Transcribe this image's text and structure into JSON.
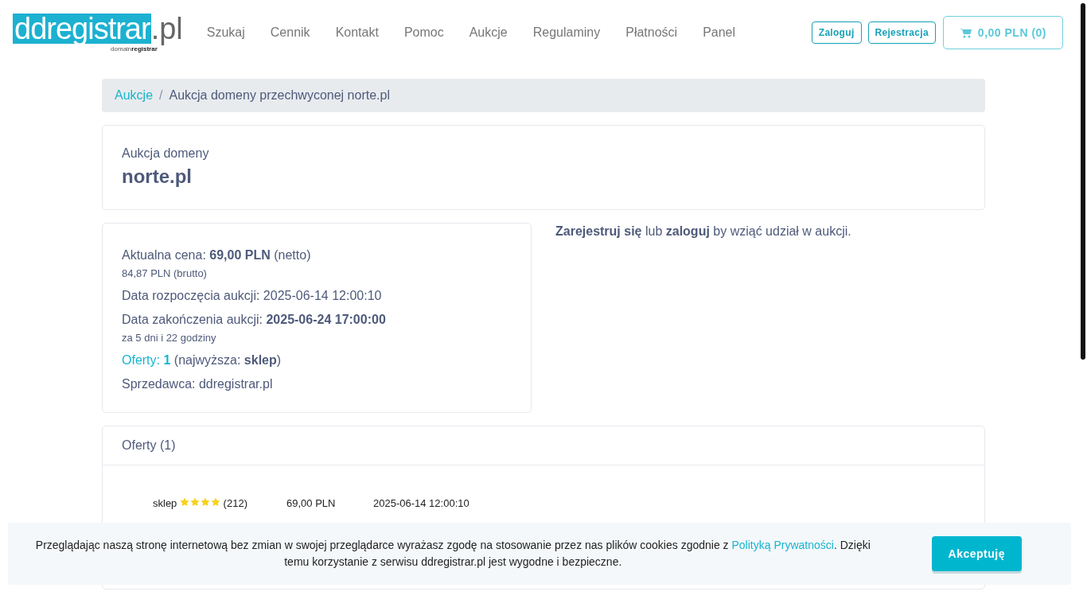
{
  "logo": {
    "main": "ddregistrar",
    "suffix": ".pl",
    "tagline_light": "domain",
    "tagline_bold": "registrar"
  },
  "nav": [
    {
      "label": "Szukaj"
    },
    {
      "label": "Cennik"
    },
    {
      "label": "Kontakt"
    },
    {
      "label": "Pomoc"
    },
    {
      "label": "Aukcje"
    },
    {
      "label": "Regulaminy"
    },
    {
      "label": "Płatności"
    },
    {
      "label": "Panel"
    }
  ],
  "header_buttons": [
    "Zaloguj",
    "Rejestracja"
  ],
  "cart": {
    "label": "0,00 PLN (0)"
  },
  "breadcrumb_separator": "/",
  "breadcrumb": [
    {
      "label": "Aukcje",
      "kind": "link"
    },
    {
      "label": "Aukcja domeny przechwyconej norte.pl",
      "kind": "current"
    }
  ],
  "title_card": {
    "subtitle": "Aukcja domeny",
    "domain": "norte.pl"
  },
  "details": [
    {
      "kind": "main",
      "text": "Aktualna cena: **69,00 PLN** (netto)"
    },
    {
      "kind": "note",
      "text": "84,87 PLN (brutto)"
    },
    {
      "kind": "main",
      "text": "Data rozpoczęcia aukcji: 2025-06-14 12:00:10"
    },
    {
      "kind": "main",
      "text": "Data zakończenia aukcji: **2025-06-24 17:00:00**"
    },
    {
      "kind": "note",
      "text": "za 5 dni i 22 godziny"
    },
    {
      "kind": "offers",
      "link": "Oferty:",
      "count": "1",
      "text": "(najwyższa: **sklep**)"
    },
    {
      "kind": "main",
      "text": "Sprzedawca: ddregistrar.pl"
    }
  ],
  "login_prompt": "**Zarejestruj się** lub **zaloguj** by wziąć udział w aukcji.",
  "offers": {
    "title": "Oferty (1)",
    "rows": [
      {
        "user": "sklep",
        "stars": 4,
        "rating_count": "(212)",
        "amount": "69,00 PLN",
        "date": "2025-06-14 12:00:10"
      }
    ]
  },
  "cookie_banner": {
    "text_before": "Przeglądając naszą stronę internetową bez zmian w swojej przeglądarce wyrażasz zgodę na stosowanie przez nas plików cookies zgodnie z ",
    "link": "Polityką Prywatności",
    "text_after": ". Dzięki temu korzystanie z serwisu ddregistrar.pl jest wygodne i bezpieczne.",
    "button": "Akceptuję"
  }
}
